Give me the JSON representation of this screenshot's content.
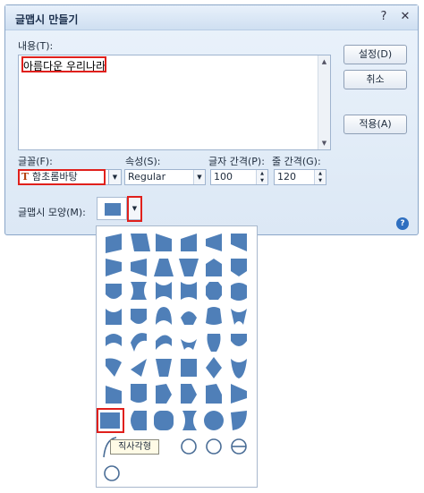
{
  "window": {
    "title": "글맵시 만들기",
    "help_glyph": "?",
    "close_glyph": "✕"
  },
  "content": {
    "label": "내용(T):",
    "value": "아름다운 우리나라"
  },
  "buttons": {
    "settings": "설정(D)",
    "cancel": "취소",
    "apply": "적용(A)"
  },
  "font": {
    "label": "글꼴(F):",
    "value": "함초롬바탕",
    "icon_glyph": "T"
  },
  "attr": {
    "label": "속성(S):",
    "value": "Regular"
  },
  "char_spacing": {
    "label": "글자 간격(P):",
    "value": "100"
  },
  "line_spacing": {
    "label": "줄 간격(G):",
    "value": "120"
  },
  "shape": {
    "label": "글맵시 모양(M):",
    "tooltip": "직사각형"
  },
  "colors": {
    "shape_fill": "#4f7fb8",
    "highlight": "#e0201c"
  }
}
